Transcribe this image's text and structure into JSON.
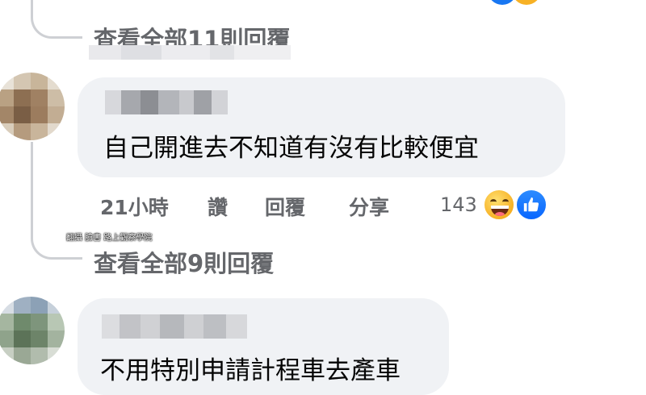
{
  "thread": {
    "view_more_1": "查看全部11則回覆",
    "view_more_2": "查看全部9則回覆"
  },
  "comment1": {
    "text": "自己開進去不知道有沒有比較便宜",
    "time": "21小時",
    "like_label": "讚",
    "reply_label": "回覆",
    "share_label": "分享",
    "reaction_count": "143",
    "reaction_icons": [
      "haha-icon",
      "like-icon"
    ]
  },
  "comment2": {
    "text": "不用特別申請計程車去產車"
  },
  "watermark": {
    "text": "翻攝 臉書 路上觀察學院"
  },
  "colors": {
    "bubble_bg": "#f0f2f5",
    "secondary_text": "#65676b",
    "thread_line": "#ced0d4",
    "like_blue": "#0866ff",
    "haha_yellow": "#f7b125"
  }
}
